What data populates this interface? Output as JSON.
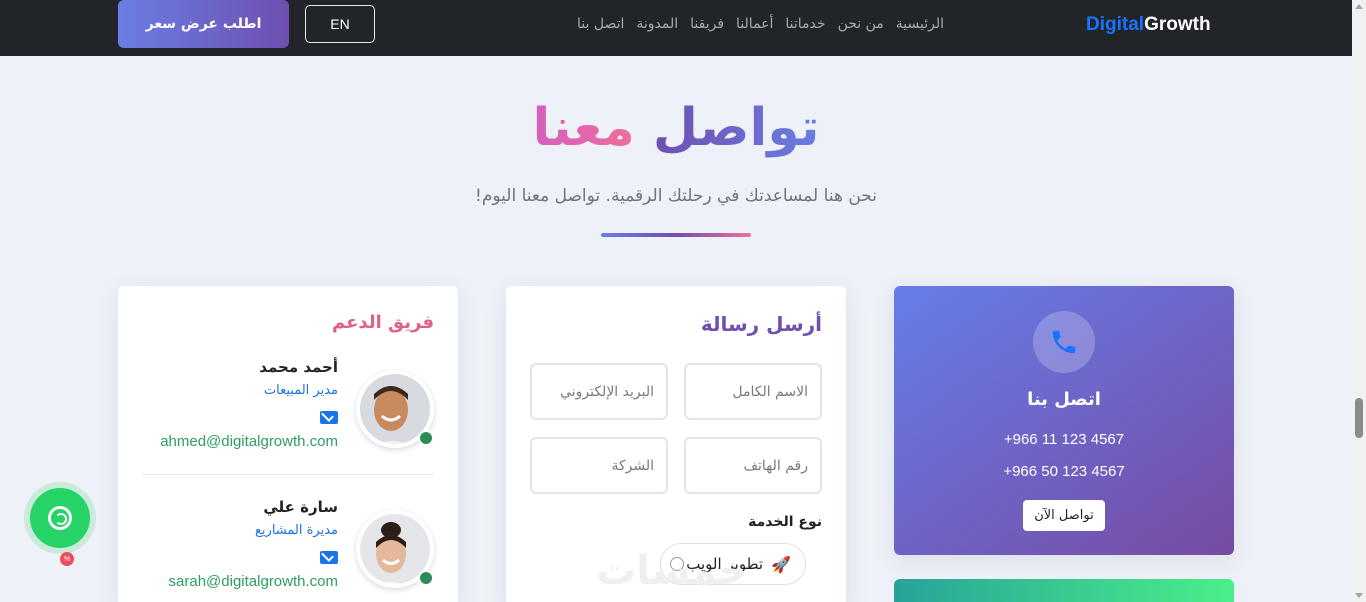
{
  "navbar": {
    "logo_part1": "Digital",
    "logo_part2": "Growth",
    "links": [
      "الرئيسية",
      "من نحن",
      "خدماتنا",
      "أعمالنا",
      "فريقنا",
      "المدونة",
      "اتصل بنا"
    ],
    "lang_button": "EN",
    "quote_button": "اطلب عرض سعر"
  },
  "hero": {
    "title_part1": "تواصل",
    "title_part2": "معنا",
    "subtitle": "نحن هنا لمساعدتك في رحلتك الرقمية. تواصل معنا اليوم!"
  },
  "team": {
    "title": "فريق الدعم",
    "members": [
      {
        "name": "أحمد محمد",
        "role": "مدير المبيعات",
        "email": "ahmed@digitalgrowth.com"
      },
      {
        "name": "سارة علي",
        "role": "مديرة المشاريع",
        "email": "sarah@digitalgrowth.com"
      }
    ]
  },
  "form": {
    "title": "أرسل رسالة",
    "placeholders": {
      "name": "الاسم الكامل",
      "email": "البريد الإلكتروني",
      "phone": "رقم الهاتف",
      "company": "الشركة"
    },
    "service_label": "نوع الخدمة",
    "service_option": "تطوير الويب",
    "service_icon": "rocket-icon"
  },
  "contact": {
    "title": "اتصل بنا",
    "phone1": "+966 11 123 4567",
    "phone2": "+966 50 123 4567",
    "button": "تواصل الآن",
    "icon": "phone-icon"
  },
  "watermark": "خمسات",
  "colors": {
    "brand_blue": "#1a73ff",
    "gradient_start": "#667eea",
    "gradient_end": "#764ba2",
    "accent_pink": "#e25f8a",
    "email_green": "#2f9e63",
    "float_green": "#25d366"
  }
}
